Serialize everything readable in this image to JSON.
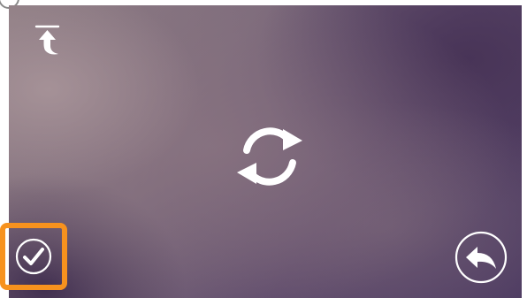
{
  "screen": {
    "icons": {
      "upload": "upload-arrow-icon",
      "sync": "sync-refresh-icon",
      "confirm": "checkmark-circle-icon",
      "back": "back-arrow-circle-icon"
    }
  },
  "colors": {
    "icon": "#ffffff",
    "highlight": "#f7921e",
    "badge_border": "#8a8a8a"
  }
}
